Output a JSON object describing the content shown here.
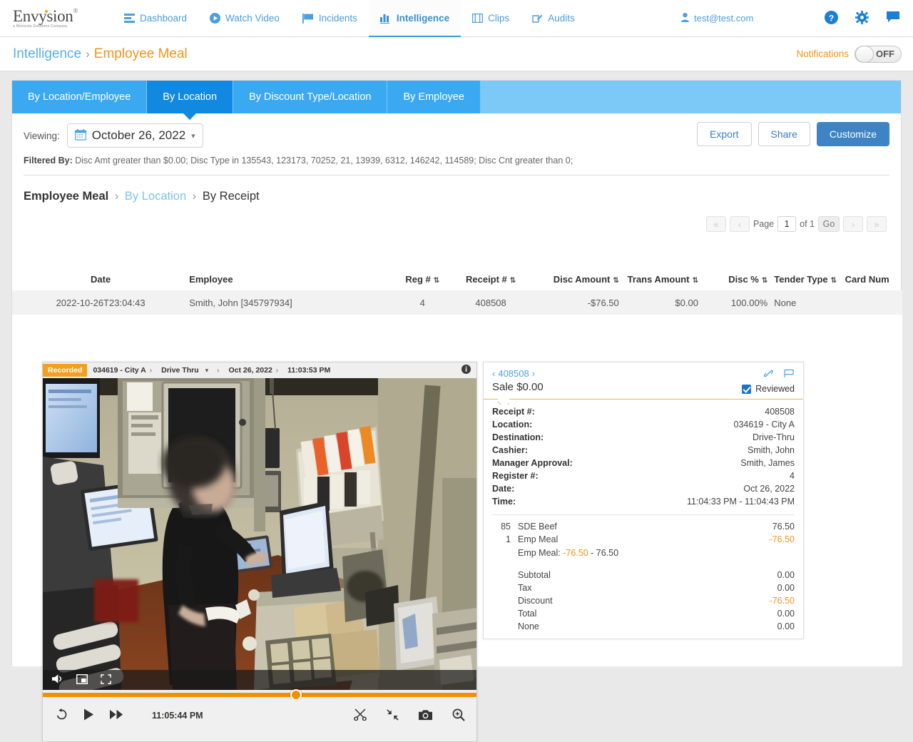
{
  "brand": {
    "name": "Envysion",
    "registered": "®",
    "tagline": "a Motorola Solutions Company"
  },
  "topnav": {
    "items": [
      {
        "label": "Dashboard",
        "icon": "dashboard-icon"
      },
      {
        "label": "Watch Video",
        "icon": "play-circle-icon"
      },
      {
        "label": "Incidents",
        "icon": "flag-icon"
      },
      {
        "label": "Intelligence",
        "icon": "bar-chart-icon"
      },
      {
        "label": "Clips",
        "icon": "film-icon"
      },
      {
        "label": "Audits",
        "icon": "edit-square-icon"
      }
    ],
    "active": "Intelligence",
    "user": "test@test.com",
    "icons": [
      "help-icon",
      "gear-icon",
      "chat-icon"
    ]
  },
  "breadcrumb": {
    "parent": "Intelligence",
    "separator": "›",
    "current": "Employee Meal"
  },
  "notifications": {
    "label": "Notifications",
    "state": "OFF"
  },
  "tabs": [
    {
      "label": "By Location/Employee",
      "active": false
    },
    {
      "label": "By Location",
      "active": true
    },
    {
      "label": "By Discount Type/Location",
      "active": false
    },
    {
      "label": "By Employee",
      "active": false
    }
  ],
  "viewing": {
    "label": "Viewing:",
    "date": "October 26, 2022",
    "calendar_icon": "calendar-icon",
    "chevron": "⌄"
  },
  "actions": {
    "export": "Export",
    "share": "Share",
    "customize": "Customize"
  },
  "filtered_by": {
    "label": "Filtered By:",
    "text": "Disc Amt greater than $0.00; Disc Type in 135543, 123173, 70252, 21, 13939, 6312, 146242, 114589; Disc Cnt greater than 0;"
  },
  "sub_breadcrumb": {
    "root": "Employee Meal",
    "link": "By Location",
    "current": "By Receipt",
    "sep": "›"
  },
  "pager": {
    "first": "«",
    "prev": "‹",
    "page_label": "Page",
    "page_value": "1",
    "of_label": "of 1",
    "go": "Go",
    "next": "›",
    "last": "»"
  },
  "table": {
    "columns": [
      {
        "label": "Date",
        "sortable": false
      },
      {
        "label": "Employee",
        "sortable": false
      },
      {
        "label": "Reg #",
        "sortable": true
      },
      {
        "label": "Receipt #",
        "sortable": true
      },
      {
        "label": "Disc Amount",
        "sortable": true
      },
      {
        "label": "Trans Amount",
        "sortable": true
      },
      {
        "label": "Disc %",
        "sortable": true
      },
      {
        "label": "Tender Type",
        "sortable": true
      },
      {
        "label": "Card Num",
        "sortable": false
      }
    ],
    "rows": [
      {
        "date": "2022-10-26T23:04:43",
        "employee": "Smith, John [345797934]",
        "reg": "4",
        "receipt": "408508",
        "disc_amount": "-$76.50",
        "trans_amount": "$0.00",
        "disc_pct": "100.00%",
        "tender_type": "None",
        "card_num": ""
      }
    ]
  },
  "player": {
    "badge": "Recorded",
    "location": "034619 - City A",
    "destination": "Drive Thru",
    "date": "Oct 26, 2022",
    "time": "11:03:53 PM",
    "sep": "›",
    "current_time": "11:05:44 PM",
    "controls": {
      "volume": "volume-icon",
      "pip": "picture-in-picture-icon",
      "fullscreen": "fullscreen-icon",
      "rewind": "rewind-icon",
      "play": "play-icon",
      "fastforward": "fast-forward-icon",
      "clip": "scissors-icon",
      "collapse": "collapse-icon",
      "snapshot": "camera-icon",
      "zoom": "magnifier-icon",
      "info": "info-icon"
    }
  },
  "receipt": {
    "nav_prev": "‹",
    "nav_next": "›",
    "number": "408508",
    "sale": "Sale $0.00",
    "reviewed_label": "Reviewed",
    "tools": [
      "link-icon",
      "flag-icon"
    ],
    "fields": [
      {
        "key": "Receipt #:",
        "value": "408508"
      },
      {
        "key": "Location:",
        "value": "034619 - City A"
      },
      {
        "key": "Destination:",
        "value": "Drive-Thru"
      },
      {
        "key": "Cashier:",
        "value": "Smith, John"
      },
      {
        "key": "Manager Approval:",
        "value": "Smith, James"
      },
      {
        "key": "Register #:",
        "value": "4"
      },
      {
        "key": "Date:",
        "value": "Oct 26, 2022"
      },
      {
        "key": "Time:",
        "value": "11:04:33 PM - 11:04:43 PM"
      }
    ],
    "items": [
      {
        "qty": "85",
        "name": "SDE Beef",
        "amount": "76.50",
        "negative": false
      },
      {
        "qty": "1",
        "name": "Emp Meal",
        "amount": "-76.50",
        "negative": true
      }
    ],
    "note_prefix": "Emp Meal: ",
    "note_neg": "-76.50",
    "note_suffix": " - 76.50",
    "totals": [
      {
        "name": "Subtotal",
        "amount": "0.00",
        "negative": false
      },
      {
        "name": "Tax",
        "amount": "0.00",
        "negative": false
      },
      {
        "name": "Discount",
        "amount": "-76.50",
        "negative": true
      },
      {
        "name": "Total",
        "amount": "0.00",
        "negative": false
      },
      {
        "name": "None",
        "amount": "0.00",
        "negative": false
      }
    ]
  },
  "colors": {
    "accent_blue": "#3aa9f2",
    "active_tab": "#1189e0",
    "orange": "#f0941e",
    "primary_button": "#3e84c4",
    "negative": "#f0941e"
  }
}
